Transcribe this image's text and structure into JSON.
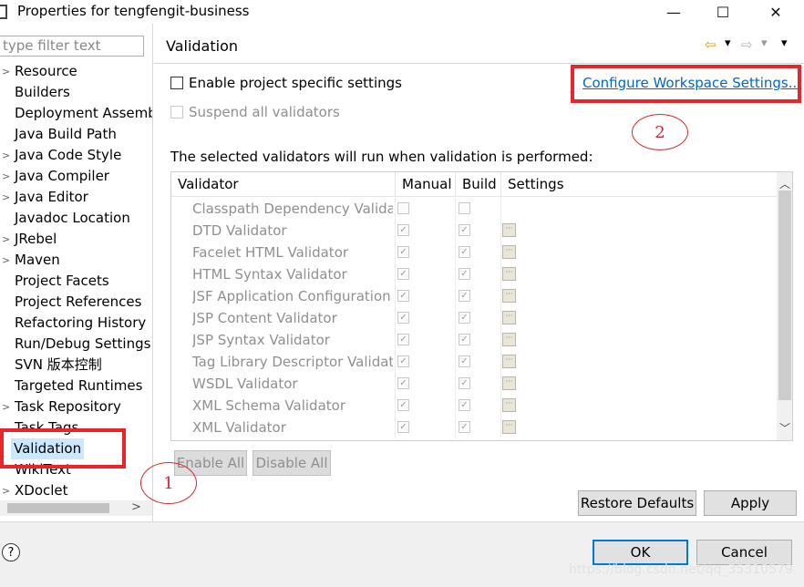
{
  "window": {
    "title": "Properties for tengfengit-business",
    "minimize": "—",
    "maximize": "☐",
    "close": "✕"
  },
  "sidebar": {
    "filter_placeholder": "type filter text",
    "items": [
      {
        "label": "Resource",
        "expandable": true
      },
      {
        "label": "Builders",
        "expandable": false
      },
      {
        "label": "Deployment Assembly",
        "expandable": false
      },
      {
        "label": "Java Build Path",
        "expandable": false
      },
      {
        "label": "Java Code Style",
        "expandable": true
      },
      {
        "label": "Java Compiler",
        "expandable": true
      },
      {
        "label": "Java Editor",
        "expandable": true
      },
      {
        "label": "Javadoc Location",
        "expandable": false
      },
      {
        "label": "JRebel",
        "expandable": true
      },
      {
        "label": "Maven",
        "expandable": true
      },
      {
        "label": "Project Facets",
        "expandable": false
      },
      {
        "label": "Project References",
        "expandable": false
      },
      {
        "label": "Refactoring History",
        "expandable": false
      },
      {
        "label": "Run/Debug Settings",
        "expandable": false
      },
      {
        "label": "SVN 版本控制",
        "expandable": false
      },
      {
        "label": "Targeted Runtimes",
        "expandable": false
      },
      {
        "label": "Task Repository",
        "expandable": true
      },
      {
        "label": "Task Tags",
        "expandable": false
      },
      {
        "label": "Validation",
        "expandable": false,
        "selected": true
      },
      {
        "label": "WikiText",
        "expandable": false
      },
      {
        "label": "XDoclet",
        "expandable": true
      }
    ]
  },
  "page": {
    "title": "Validation",
    "enable_project_specific": "Enable project specific settings",
    "suspend_all": "Suspend all validators",
    "configure_link": "Configure Workspace Settings...",
    "description": "The selected validators will run when validation is performed:",
    "table": {
      "headers": [
        "Validator",
        "Manual",
        "Build",
        "Settings"
      ],
      "rows": [
        {
          "name": "Classpath Dependency Validator",
          "manual": false,
          "build": false
        },
        {
          "name": "DTD Validator",
          "manual": true,
          "build": true
        },
        {
          "name": "Facelet HTML Validator",
          "manual": true,
          "build": true
        },
        {
          "name": "HTML Syntax Validator",
          "manual": true,
          "build": true
        },
        {
          "name": "JSF Application Configuration Validator",
          "manual": true,
          "build": true
        },
        {
          "name": "JSP Content Validator",
          "manual": true,
          "build": true
        },
        {
          "name": "JSP Syntax Validator",
          "manual": true,
          "build": true
        },
        {
          "name": "Tag Library Descriptor Validator",
          "manual": true,
          "build": true
        },
        {
          "name": "WSDL Validator",
          "manual": true,
          "build": true
        },
        {
          "name": "XML Schema Validator",
          "manual": true,
          "build": true
        },
        {
          "name": "XML Validator",
          "manual": true,
          "build": true
        }
      ],
      "settings_glyph": "···"
    },
    "enable_all": "Enable All",
    "disable_all": "Disable All",
    "restore_defaults": "Restore Defaults",
    "apply": "Apply"
  },
  "footer": {
    "help": "?",
    "ok": "OK",
    "cancel": "Cancel",
    "watermark": "https://blog.csdn.net/qq_35310579"
  },
  "annotations": {
    "marker_1": "1",
    "marker_2": "2",
    "highlight_color": "#e8262a"
  },
  "colors": {
    "selection": "#cce8ff",
    "link": "#0066cc",
    "default_button_border": "#0078d7"
  }
}
